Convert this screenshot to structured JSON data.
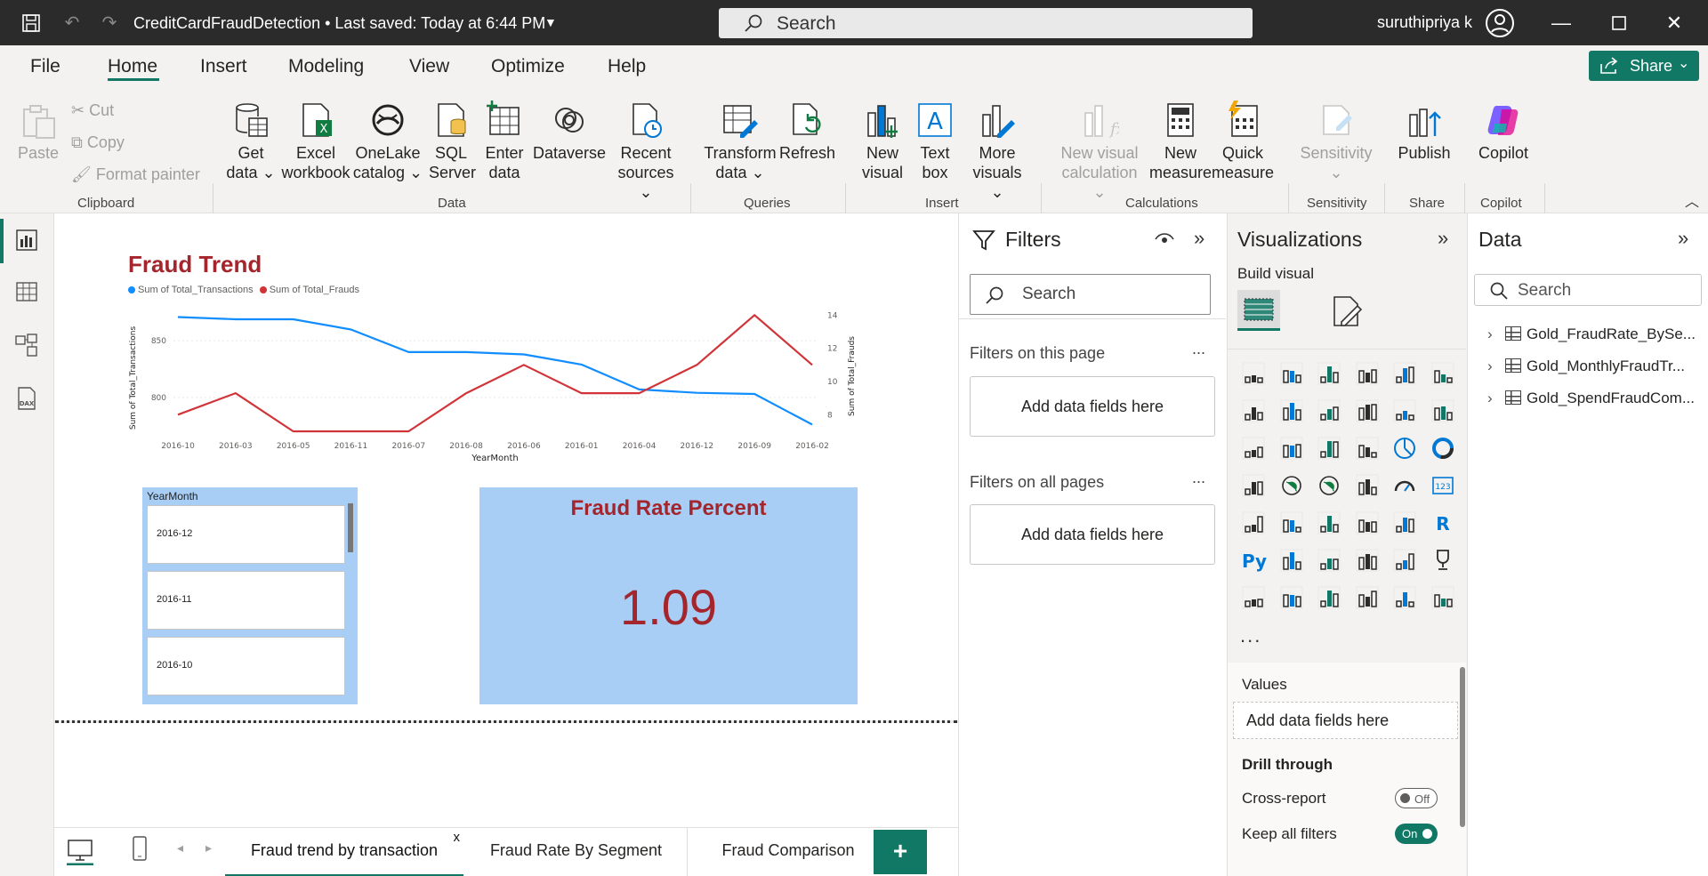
{
  "titlebar": {
    "doc_title": "CreditCardFraudDetection • Last saved: Today at 6:44 PM",
    "search_placeholder": "Search",
    "user_name": "suruthipriya k"
  },
  "menu": {
    "tabs": [
      "File",
      "Home",
      "Insert",
      "Modeling",
      "View",
      "Optimize",
      "Help"
    ],
    "active_tab": "Home",
    "share_label": "Share"
  },
  "ribbon": {
    "clipboard": {
      "paste": "Paste",
      "cut": "Cut",
      "copy": "Copy",
      "format_painter": "Format painter",
      "label": "Clipboard"
    },
    "data": {
      "get_data": [
        "Get",
        "data"
      ],
      "excel": [
        "Excel",
        "workbook"
      ],
      "onelake": [
        "OneLake",
        "catalog"
      ],
      "sql": [
        "SQL",
        "Server"
      ],
      "enter": [
        "Enter",
        "data"
      ],
      "dataverse": "Dataverse",
      "recent": [
        "Recent",
        "sources"
      ],
      "label": "Data"
    },
    "queries": {
      "transform": [
        "Transform",
        "data"
      ],
      "refresh": "Refresh",
      "label": "Queries"
    },
    "insert": {
      "new_visual": [
        "New",
        "visual"
      ],
      "text_box": [
        "Text",
        "box"
      ],
      "more_visuals": [
        "More",
        "visuals"
      ],
      "label": "Insert"
    },
    "calculations": {
      "new_visual_calc": [
        "New visual",
        "calculation"
      ],
      "new_measure": [
        "New",
        "measure"
      ],
      "quick_measure": [
        "Quick",
        "measure"
      ],
      "label": "Calculations"
    },
    "sensitivity": {
      "btn": "Sensitivity",
      "label": "Sensitivity"
    },
    "share": {
      "publish": "Publish",
      "label": "Share"
    },
    "copilot": {
      "btn": "Copilot",
      "label": "Copilot"
    }
  },
  "report": {
    "chart_title": "Fraud Trend",
    "legend": [
      "Sum of Total_Transactions",
      "Sum of Total_Frauds"
    ],
    "slicer": {
      "header": "YearMonth",
      "items": [
        "2016-12",
        "2016-11",
        "2016-10"
      ]
    },
    "card": {
      "title": "Fraud Rate Percent",
      "value": "1.09"
    }
  },
  "chart_data": {
    "type": "line",
    "title": "Fraud Trend",
    "xlabel": "YearMonth",
    "ylabel": "Sum of Total_Transactions",
    "y2label": "Sum of Total_Frauds",
    "categories": [
      "2016-10",
      "2016-03",
      "2016-05",
      "2016-11",
      "2016-07",
      "2016-08",
      "2016-06",
      "2016-01",
      "2016-04",
      "2016-12",
      "2016-09",
      "2016-02"
    ],
    "series": [
      {
        "name": "Sum of Total_Transactions",
        "axis": "left",
        "color": "#118dff",
        "values": [
          871,
          869,
          869,
          860,
          840,
          840,
          838,
          829,
          807,
          804,
          803,
          776
        ]
      },
      {
        "name": "Sum of Total_Frauds",
        "axis": "right",
        "color": "#d13438",
        "values": [
          8,
          9.3,
          7,
          7,
          7,
          9.3,
          11,
          9.3,
          9.3,
          11,
          14,
          11
        ]
      }
    ],
    "ylim": [
      770,
      880
    ],
    "y2lim": [
      7,
      14.5
    ],
    "yticks": [
      800,
      850
    ],
    "y2ticks": [
      8,
      10,
      12,
      14
    ],
    "legend_position": "top-left",
    "grid": true
  },
  "pages": {
    "tabs": [
      "Fraud trend by transaction",
      "Fraud Rate By Segment",
      "Fraud Comparison"
    ],
    "active": "Fraud trend by transaction",
    "close_glyph": "x",
    "add_glyph": "+"
  },
  "filters": {
    "title": "Filters",
    "search_placeholder": "Search",
    "on_this_page": "Filters on this page",
    "on_all_pages": "Filters on all pages",
    "drop_text": "Add data fields here",
    "more": "..."
  },
  "visualizations": {
    "title": "Visualizations",
    "subtitle": "Build visual",
    "more": "...",
    "values_label": "Values",
    "values_drop": "Add data fields here",
    "drill_through": "Drill through",
    "cross_report": "Cross-report",
    "cross_report_state": "Off",
    "keep_all_filters": "Keep all filters",
    "keep_all_state": "On",
    "r_label": "R",
    "py_label": "Py"
  },
  "data_pane": {
    "title": "Data",
    "search_placeholder": "Search",
    "tables": [
      "Gold_FraudRate_BySe...",
      "Gold_MonthlyFraudTr...",
      "Gold_SpendFraudCom..."
    ]
  },
  "colors": {
    "accent": "#117865",
    "title_red": "#a4262c",
    "card_bg": "#a8cef5",
    "line_blue": "#118dff",
    "line_red": "#d13438"
  }
}
